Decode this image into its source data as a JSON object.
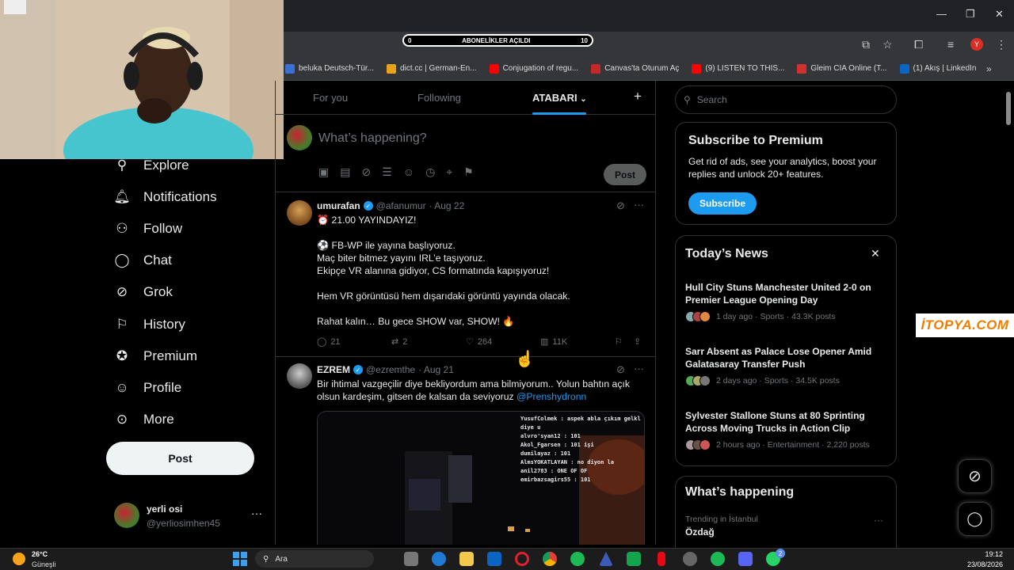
{
  "browser": {
    "subscription_bar": {
      "left": "0",
      "label": "ABONELİKLER AÇILDI",
      "right": "10"
    },
    "bookmarks": [
      {
        "label": "beluka Deutsch-Tür...",
        "color": "#3b6fd6"
      },
      {
        "label": "dict.cc | German-En...",
        "color": "#e8a317"
      },
      {
        "label": "Conjugation of regu...",
        "color": "#ff0000"
      },
      {
        "label": "Canvas'ta Oturum Aç",
        "color": "#c62828"
      },
      {
        "label": "(9) LISTEN TO THIS...",
        "color": "#ff0000"
      },
      {
        "label": "Gleim CIA Online (T...",
        "color": "#d32f2f"
      },
      {
        "label": "(1) Akış | LinkedIn",
        "color": "#0a66c2"
      }
    ],
    "profile_initial": "Y"
  },
  "nav": {
    "items": [
      {
        "label": "Explore",
        "icon": "search-icon"
      },
      {
        "label": "Notifications",
        "icon": "bell-icon"
      },
      {
        "label": "Follow",
        "icon": "person-plus-icon"
      },
      {
        "label": "Chat",
        "icon": "chat-icon"
      },
      {
        "label": "Grok",
        "icon": "grok-icon"
      },
      {
        "label": "History",
        "icon": "bookmark-icon"
      },
      {
        "label": "Premium",
        "icon": "verified-icon"
      },
      {
        "label": "Profile",
        "icon": "person-icon"
      },
      {
        "label": "More",
        "icon": "more-circle-icon"
      }
    ],
    "post_label": "Post",
    "account": {
      "name": "yerli osi",
      "handle": "@yerliosimhen45"
    }
  },
  "timeline": {
    "tabs": [
      "For you",
      "Following",
      "ATABARI"
    ],
    "composer_placeholder": "What’s happening?",
    "composer_post": "Post",
    "tweets": [
      {
        "name": "umurafan",
        "handle": "@afanumur",
        "date": "· Aug 22",
        "lines": [
          "⏰ 21.00 YAYINDAYIZ!",
          "",
          "⚽ FB-WP ile yayına başlıyoruz.",
          "Maç biter bitmez yayını IRL’e taşıyoruz.",
          "Ekipçe VR alanına gidiyor, CS formatında kapışıyoruz!",
          "",
          "Hem VR görüntüsü hem dışarıdaki görüntü yayında olacak.",
          "",
          "Rahat kalın… Bu gece SHOW var, SHOW! 🔥"
        ],
        "replies": "21",
        "reposts": "2",
        "likes": "264",
        "views": "11K"
      },
      {
        "name": "EZREM",
        "handle": "@ezremthe",
        "date": "· Aug 21",
        "text": "Bir ihtimal vazgeçilir diye bekliyordum ama bilmiyorum.. Yolun bahtın açık olsun kardeşim, gitsen de kalsan da seviyoruz",
        "mention": "@Prenshydronn",
        "chat_lines": [
          "YusufColmek : aspek abla çıkım gelkl diye u",
          "alvro'syan12 : 101",
          "Akol_Fgarsen : 101 işi",
          "dumilayaz : 101",
          "AlmsYOKATLAYAN : no diyon la",
          "anil2783 : ONE OF OF",
          "emirbazsagirs55 : 101"
        ]
      }
    ]
  },
  "right": {
    "search_placeholder": "Search",
    "premium": {
      "title": "Subscribe to Premium",
      "text": "Get rid of ads, see your analytics, boost your replies and unlock 20+ features.",
      "button": "Subscribe"
    },
    "news": {
      "title": "Today’s News",
      "items": [
        {
          "title": "Hull City Stuns Manchester United 2-0 on Premier League Opening Day",
          "meta": "1 day ago · Sports · 43.3K posts"
        },
        {
          "title": "Sarr Absent as Palace Lose Opener Amid Galatasaray Transfer Push",
          "meta": "2 days ago · Sports · 34.5K posts"
        },
        {
          "title": "Sylvester Stallone Stuns at 80 Sprinting Across Moving Trucks in Action Clip",
          "meta": "2 hours ago · Entertainment · 2,220 posts"
        }
      ]
    },
    "happening": {
      "title": "What’s happening",
      "trend_context": "Trending in İstanbul",
      "trend_name": "Özdağ"
    }
  },
  "watermark": "İTOPYA.COM",
  "taskbar": {
    "weather_temp": "26°C",
    "weather_desc": "Güneşli",
    "search_label": "Ara",
    "time": "19:12",
    "date": "23/08/2026",
    "badge": "2"
  }
}
